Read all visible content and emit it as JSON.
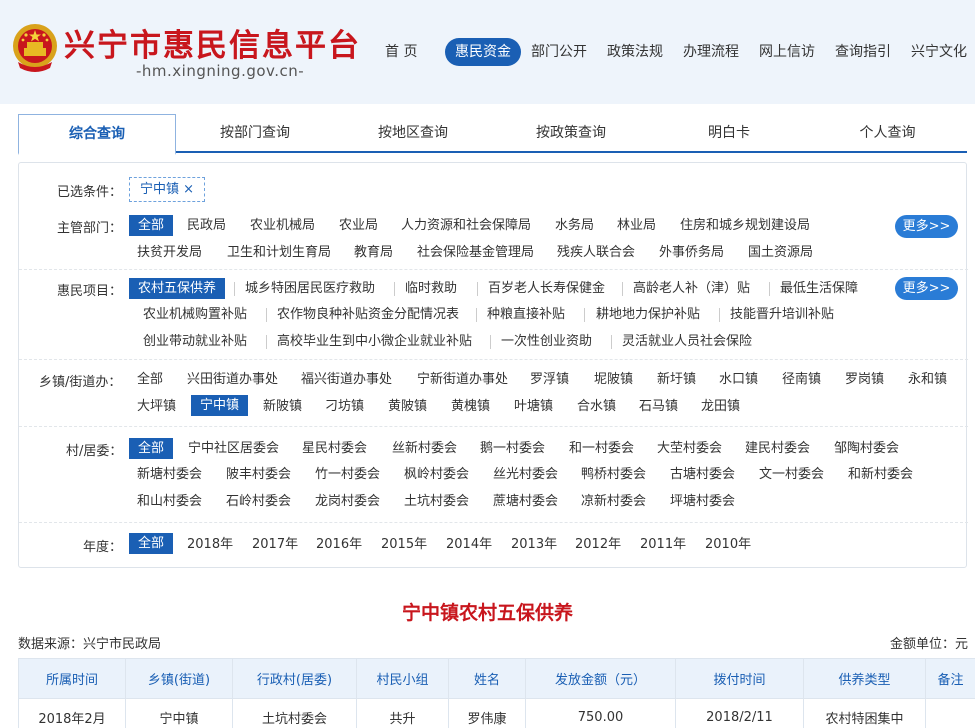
{
  "header": {
    "site_title": "兴宁市惠民信息平台",
    "site_domain": "-hm.xingning.gov.cn-",
    "nav": [
      "首 页",
      "惠民资金",
      "部门公开",
      "政策法规",
      "办理流程",
      "网上信访",
      "查询指引",
      "兴宁文化"
    ],
    "nav_active": "惠民资金"
  },
  "tabs": [
    "综合查询",
    "按部门查询",
    "按地区查询",
    "按政策查询",
    "明白卡",
    "个人查询"
  ],
  "tab_active": "综合查询",
  "filters": {
    "selected_label": "已选条件：",
    "selected_chip": "宁中镇 ×",
    "more_label": "更多>>",
    "dept": {
      "label": "主管部门：",
      "row1": [
        "全部",
        "民政局",
        "农业机械局",
        "农业局",
        "人力资源和社会保障局",
        "水务局",
        "林业局",
        "住房和城乡规划建设局"
      ],
      "row2": [
        "扶贫开发局",
        "卫生和计划生育局",
        "教育局",
        "社会保险基金管理局",
        "残疾人联合会",
        "外事侨务局",
        "国土资源局"
      ],
      "active": "全部"
    },
    "project": {
      "label": "惠民项目：",
      "row1": [
        "农村五保供养",
        "城乡特困居民医疗救助",
        "临时救助",
        "百岁老人长寿保健金",
        "高龄老人补（津）贴",
        "最低生活保障"
      ],
      "row2": [
        "农业机械购置补贴",
        "农作物良种补贴资金分配情况表",
        "种粮直接补贴",
        "耕地地力保护补贴",
        "技能晋升培训补贴"
      ],
      "row3": [
        "创业带动就业补贴",
        "高校毕业生到中小微企业就业补贴",
        "一次性创业资助",
        "灵活就业人员社会保险"
      ],
      "active": "农村五保供养"
    },
    "town": {
      "label": "乡镇/街道办：",
      "row1": [
        "全部",
        "兴田街道办事处",
        "福兴街道办事处",
        "宁新街道办事处",
        "罗浮镇",
        "坭陂镇",
        "新圩镇",
        "水口镇",
        "径南镇",
        "罗岗镇",
        "永和镇"
      ],
      "row2": [
        "大坪镇",
        "宁中镇",
        "新陂镇",
        "刁坊镇",
        "黄陂镇",
        "黄槐镇",
        "叶塘镇",
        "合水镇",
        "石马镇",
        "龙田镇"
      ],
      "active": "宁中镇"
    },
    "village": {
      "label": "村/居委：",
      "row1": [
        "全部",
        "宁中社区居委会",
        "星民村委会",
        "丝新村委会",
        "鹅一村委会",
        "和一村委会",
        "大茔村委会",
        "建民村委会",
        "邹陶村委会"
      ],
      "row2": [
        "新塘村委会",
        "陂丰村委会",
        "竹一村委会",
        "枫岭村委会",
        "丝光村委会",
        "鸭桥村委会",
        "古塘村委会",
        "文一村委会",
        "和新村委会"
      ],
      "row3": [
        "和山村委会",
        "石岭村委会",
        "龙岗村委会",
        "土坑村委会",
        "蔗塘村委会",
        "凉新村委会",
        "坪塘村委会"
      ],
      "active": "全部"
    },
    "year": {
      "label": "年度：",
      "options": [
        "全部",
        "2018年",
        "2017年",
        "2016年",
        "2015年",
        "2014年",
        "2013年",
        "2012年",
        "2011年",
        "2010年"
      ],
      "active": "全部"
    }
  },
  "result": {
    "title": "宁中镇农村五保供养",
    "source": "数据来源：兴宁市民政局",
    "unit": "金额单位：元",
    "columns": [
      "所属时间",
      "乡镇(街道)",
      "行政村(居委)",
      "村民小组",
      "姓名",
      "发放金额（元）",
      "拨付时间",
      "供养类型",
      "备注"
    ],
    "rows": [
      [
        "2018年2月",
        "宁中镇",
        "土坑村委会",
        "共升",
        "罗伟康",
        "750.00",
        "2018/2/11",
        "农村特困集中",
        ""
      ]
    ]
  },
  "colors": {
    "accent": "#1a5fb4",
    "title_red": "#c8161d",
    "more_button": "#2a7cd6",
    "header_bg": "#eef4fb"
  },
  "icons": [
    "national-emblem-icon",
    "close-icon"
  ]
}
